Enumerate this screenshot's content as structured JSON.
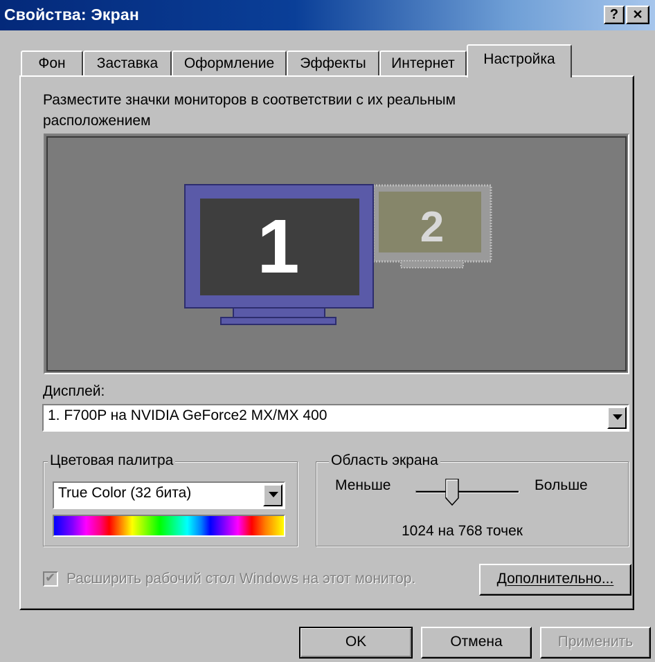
{
  "window": {
    "title": "Свойства: Экран",
    "help_button": "?",
    "close_button": "✕"
  },
  "tabs": [
    {
      "label": "Фон",
      "active": false
    },
    {
      "label": "Заставка",
      "active": false
    },
    {
      "label": "Оформление",
      "active": false
    },
    {
      "label": "Эффекты",
      "active": false
    },
    {
      "label": "Интернет",
      "active": false
    },
    {
      "label": "Настройка",
      "active": true
    }
  ],
  "settings": {
    "instruction_line1": "Разместите значки мониторов в соответствии с их реальным",
    "instruction_line2": "расположением",
    "monitor1_label": "1",
    "monitor2_label": "2",
    "monitor1_color": "#5a5aa8",
    "monitor2_color": "#86866a",
    "display_label": "Дисплей:",
    "display_value": "1. F700P на NVIDIA GeForce2 MX/MX 400",
    "color_group_label": "Цветовая палитра",
    "color_value": "True Color (32 бита)",
    "area_group_label": "Область экрана",
    "slider_less": "Меньше",
    "slider_more": "Больше",
    "slider_position_fraction": 0.35,
    "resolution_text": "1024 на 768 точек",
    "extend_checkbox_label": "Расширить рабочий стол Windows на этот монитор.",
    "extend_checked": true,
    "extend_disabled": true,
    "advanced_button": "Дополнительно..."
  },
  "buttons": {
    "ok": "OK",
    "cancel": "Отмена",
    "apply": "Применить"
  }
}
